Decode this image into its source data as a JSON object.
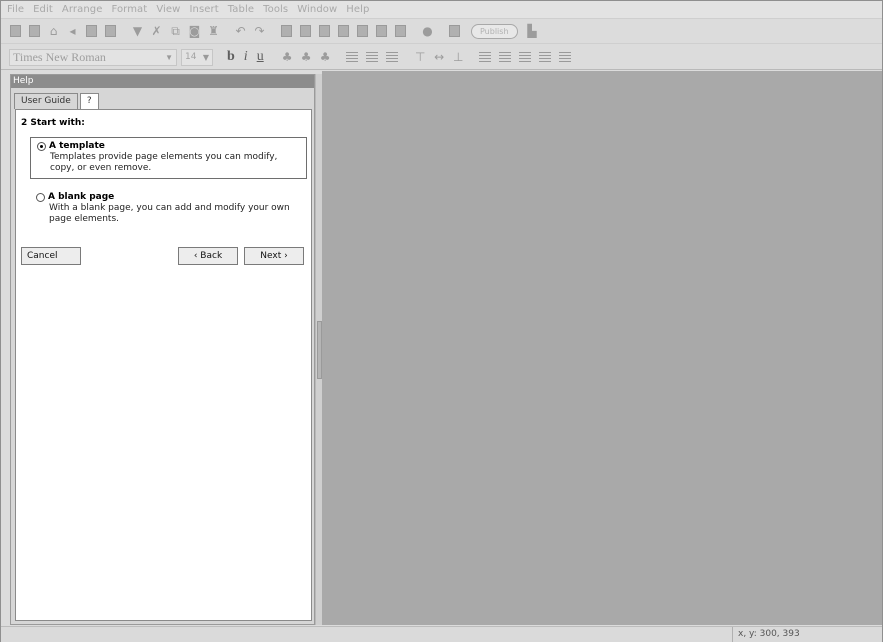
{
  "menu": [
    "File",
    "Edit",
    "Arrange",
    "Format",
    "View",
    "Insert",
    "Table",
    "Tools",
    "Window",
    "Help"
  ],
  "toolbar": {
    "publish_label": "Publish",
    "font_name": "Times New Roman",
    "font_size": "14",
    "bold": "b",
    "italic": "i",
    "underline": "u"
  },
  "help": {
    "panel_title": "Help",
    "tabs": [
      "User Guide",
      "?"
    ],
    "step_title": "2  Start with:",
    "options": [
      {
        "title": "A template",
        "desc": "Templates provide page elements you can modify, copy, or even remove.",
        "selected": true
      },
      {
        "title": "A blank page",
        "desc": "With a blank page, you can add and modify your own page elements.",
        "selected": false
      }
    ],
    "cancel_label": "Cancel",
    "back_label": "‹ Back",
    "next_label": "Next ›"
  },
  "status": {
    "coords": "x, y: 300, 393"
  }
}
